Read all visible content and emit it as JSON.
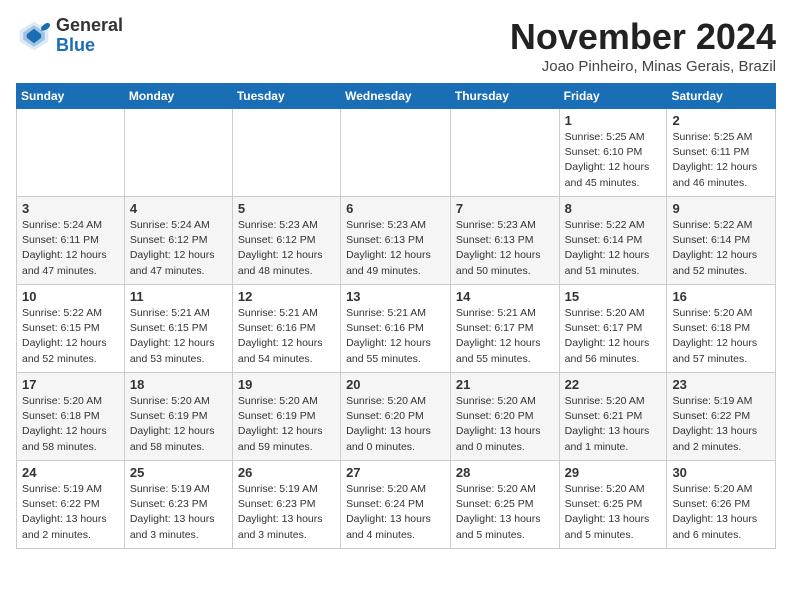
{
  "logo": {
    "general": "General",
    "blue": "Blue"
  },
  "header": {
    "month": "November 2024",
    "location": "Joao Pinheiro, Minas Gerais, Brazil"
  },
  "weekdays": [
    "Sunday",
    "Monday",
    "Tuesday",
    "Wednesday",
    "Thursday",
    "Friday",
    "Saturday"
  ],
  "weeks": [
    [
      {
        "day": "",
        "info": ""
      },
      {
        "day": "",
        "info": ""
      },
      {
        "day": "",
        "info": ""
      },
      {
        "day": "",
        "info": ""
      },
      {
        "day": "",
        "info": ""
      },
      {
        "day": "1",
        "info": "Sunrise: 5:25 AM\nSunset: 6:10 PM\nDaylight: 12 hours\nand 45 minutes."
      },
      {
        "day": "2",
        "info": "Sunrise: 5:25 AM\nSunset: 6:11 PM\nDaylight: 12 hours\nand 46 minutes."
      }
    ],
    [
      {
        "day": "3",
        "info": "Sunrise: 5:24 AM\nSunset: 6:11 PM\nDaylight: 12 hours\nand 47 minutes."
      },
      {
        "day": "4",
        "info": "Sunrise: 5:24 AM\nSunset: 6:12 PM\nDaylight: 12 hours\nand 47 minutes."
      },
      {
        "day": "5",
        "info": "Sunrise: 5:23 AM\nSunset: 6:12 PM\nDaylight: 12 hours\nand 48 minutes."
      },
      {
        "day": "6",
        "info": "Sunrise: 5:23 AM\nSunset: 6:13 PM\nDaylight: 12 hours\nand 49 minutes."
      },
      {
        "day": "7",
        "info": "Sunrise: 5:23 AM\nSunset: 6:13 PM\nDaylight: 12 hours\nand 50 minutes."
      },
      {
        "day": "8",
        "info": "Sunrise: 5:22 AM\nSunset: 6:14 PM\nDaylight: 12 hours\nand 51 minutes."
      },
      {
        "day": "9",
        "info": "Sunrise: 5:22 AM\nSunset: 6:14 PM\nDaylight: 12 hours\nand 52 minutes."
      }
    ],
    [
      {
        "day": "10",
        "info": "Sunrise: 5:22 AM\nSunset: 6:15 PM\nDaylight: 12 hours\nand 52 minutes."
      },
      {
        "day": "11",
        "info": "Sunrise: 5:21 AM\nSunset: 6:15 PM\nDaylight: 12 hours\nand 53 minutes."
      },
      {
        "day": "12",
        "info": "Sunrise: 5:21 AM\nSunset: 6:16 PM\nDaylight: 12 hours\nand 54 minutes."
      },
      {
        "day": "13",
        "info": "Sunrise: 5:21 AM\nSunset: 6:16 PM\nDaylight: 12 hours\nand 55 minutes."
      },
      {
        "day": "14",
        "info": "Sunrise: 5:21 AM\nSunset: 6:17 PM\nDaylight: 12 hours\nand 55 minutes."
      },
      {
        "day": "15",
        "info": "Sunrise: 5:20 AM\nSunset: 6:17 PM\nDaylight: 12 hours\nand 56 minutes."
      },
      {
        "day": "16",
        "info": "Sunrise: 5:20 AM\nSunset: 6:18 PM\nDaylight: 12 hours\nand 57 minutes."
      }
    ],
    [
      {
        "day": "17",
        "info": "Sunrise: 5:20 AM\nSunset: 6:18 PM\nDaylight: 12 hours\nand 58 minutes."
      },
      {
        "day": "18",
        "info": "Sunrise: 5:20 AM\nSunset: 6:19 PM\nDaylight: 12 hours\nand 58 minutes."
      },
      {
        "day": "19",
        "info": "Sunrise: 5:20 AM\nSunset: 6:19 PM\nDaylight: 12 hours\nand 59 minutes."
      },
      {
        "day": "20",
        "info": "Sunrise: 5:20 AM\nSunset: 6:20 PM\nDaylight: 13 hours\nand 0 minutes."
      },
      {
        "day": "21",
        "info": "Sunrise: 5:20 AM\nSunset: 6:20 PM\nDaylight: 13 hours\nand 0 minutes."
      },
      {
        "day": "22",
        "info": "Sunrise: 5:20 AM\nSunset: 6:21 PM\nDaylight: 13 hours\nand 1 minute."
      },
      {
        "day": "23",
        "info": "Sunrise: 5:19 AM\nSunset: 6:22 PM\nDaylight: 13 hours\nand 2 minutes."
      }
    ],
    [
      {
        "day": "24",
        "info": "Sunrise: 5:19 AM\nSunset: 6:22 PM\nDaylight: 13 hours\nand 2 minutes."
      },
      {
        "day": "25",
        "info": "Sunrise: 5:19 AM\nSunset: 6:23 PM\nDaylight: 13 hours\nand 3 minutes."
      },
      {
        "day": "26",
        "info": "Sunrise: 5:19 AM\nSunset: 6:23 PM\nDaylight: 13 hours\nand 3 minutes."
      },
      {
        "day": "27",
        "info": "Sunrise: 5:20 AM\nSunset: 6:24 PM\nDaylight: 13 hours\nand 4 minutes."
      },
      {
        "day": "28",
        "info": "Sunrise: 5:20 AM\nSunset: 6:25 PM\nDaylight: 13 hours\nand 5 minutes."
      },
      {
        "day": "29",
        "info": "Sunrise: 5:20 AM\nSunset: 6:25 PM\nDaylight: 13 hours\nand 5 minutes."
      },
      {
        "day": "30",
        "info": "Sunrise: 5:20 AM\nSunset: 6:26 PM\nDaylight: 13 hours\nand 6 minutes."
      }
    ]
  ]
}
